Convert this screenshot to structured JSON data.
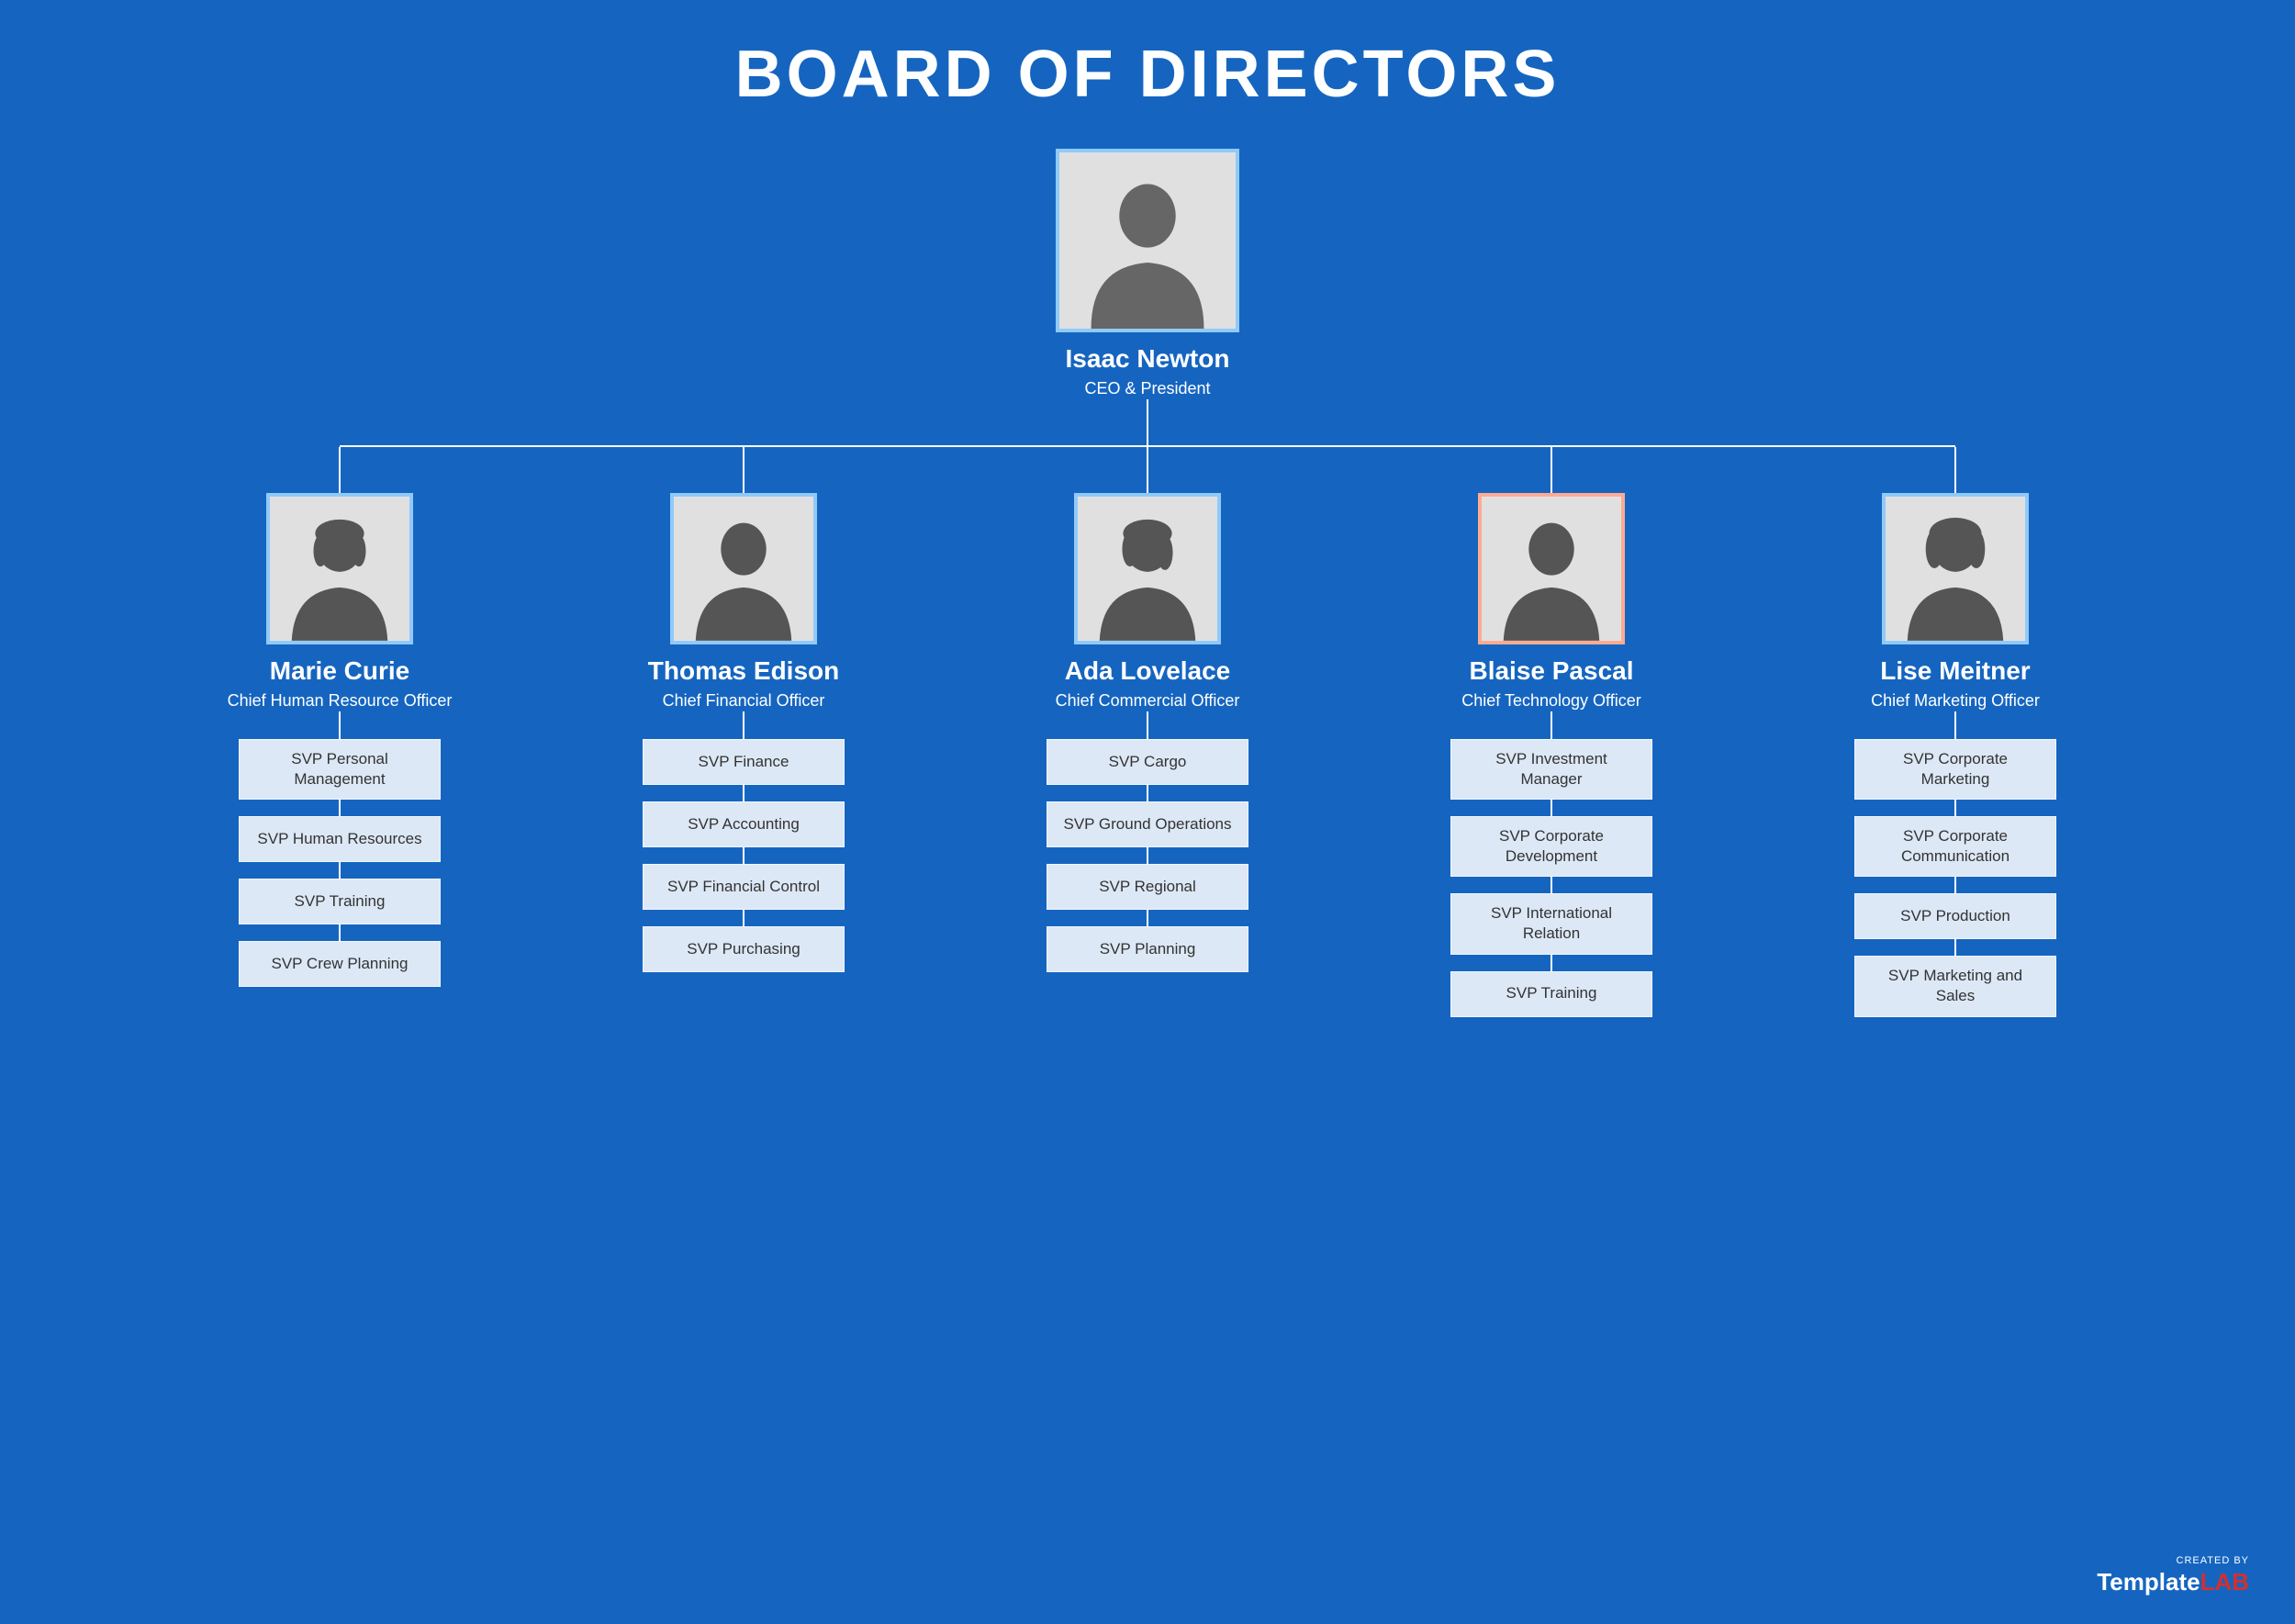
{
  "title": "BOARD OF DIRECTORS",
  "ceo": {
    "name": "Isaac Newton",
    "role": "CEO & President",
    "gender": "male"
  },
  "children": [
    {
      "name": "Marie Curie",
      "role": "Chief Human Resource Officer",
      "gender": "female",
      "svp": [
        "SVP Personal Management",
        "SVP Human Resources",
        "SVP Training",
        "SVP Crew Planning"
      ]
    },
    {
      "name": "Thomas Edison",
      "role": "Chief Financial Officer",
      "gender": "male",
      "svp": [
        "SVP Finance",
        "SVP Accounting",
        "SVP Financial Control",
        "SVP Purchasing"
      ]
    },
    {
      "name": "Ada Lovelace",
      "role": "Chief Commercial Officer",
      "gender": "female",
      "svp": [
        "SVP Cargo",
        "SVP Ground Operations",
        "SVP Regional",
        "SVP Planning"
      ]
    },
    {
      "name": "Blaise Pascal",
      "role": "Chief Technology Officer",
      "gender": "male",
      "svp": [
        "SVP Investment Manager",
        "SVP Corporate Development",
        "SVP International Relation",
        "SVP Training"
      ]
    },
    {
      "name": "Lise Meitner",
      "role": "Chief Marketing Officer",
      "gender": "female",
      "svp": [
        "SVP Corporate Marketing",
        "SVP Corporate Communication",
        "SVP Production",
        "SVP Marketing and Sales"
      ]
    }
  ],
  "watermark": {
    "created_by": "CREATED BY",
    "brand_white": "Template",
    "brand_red": "LAB"
  }
}
